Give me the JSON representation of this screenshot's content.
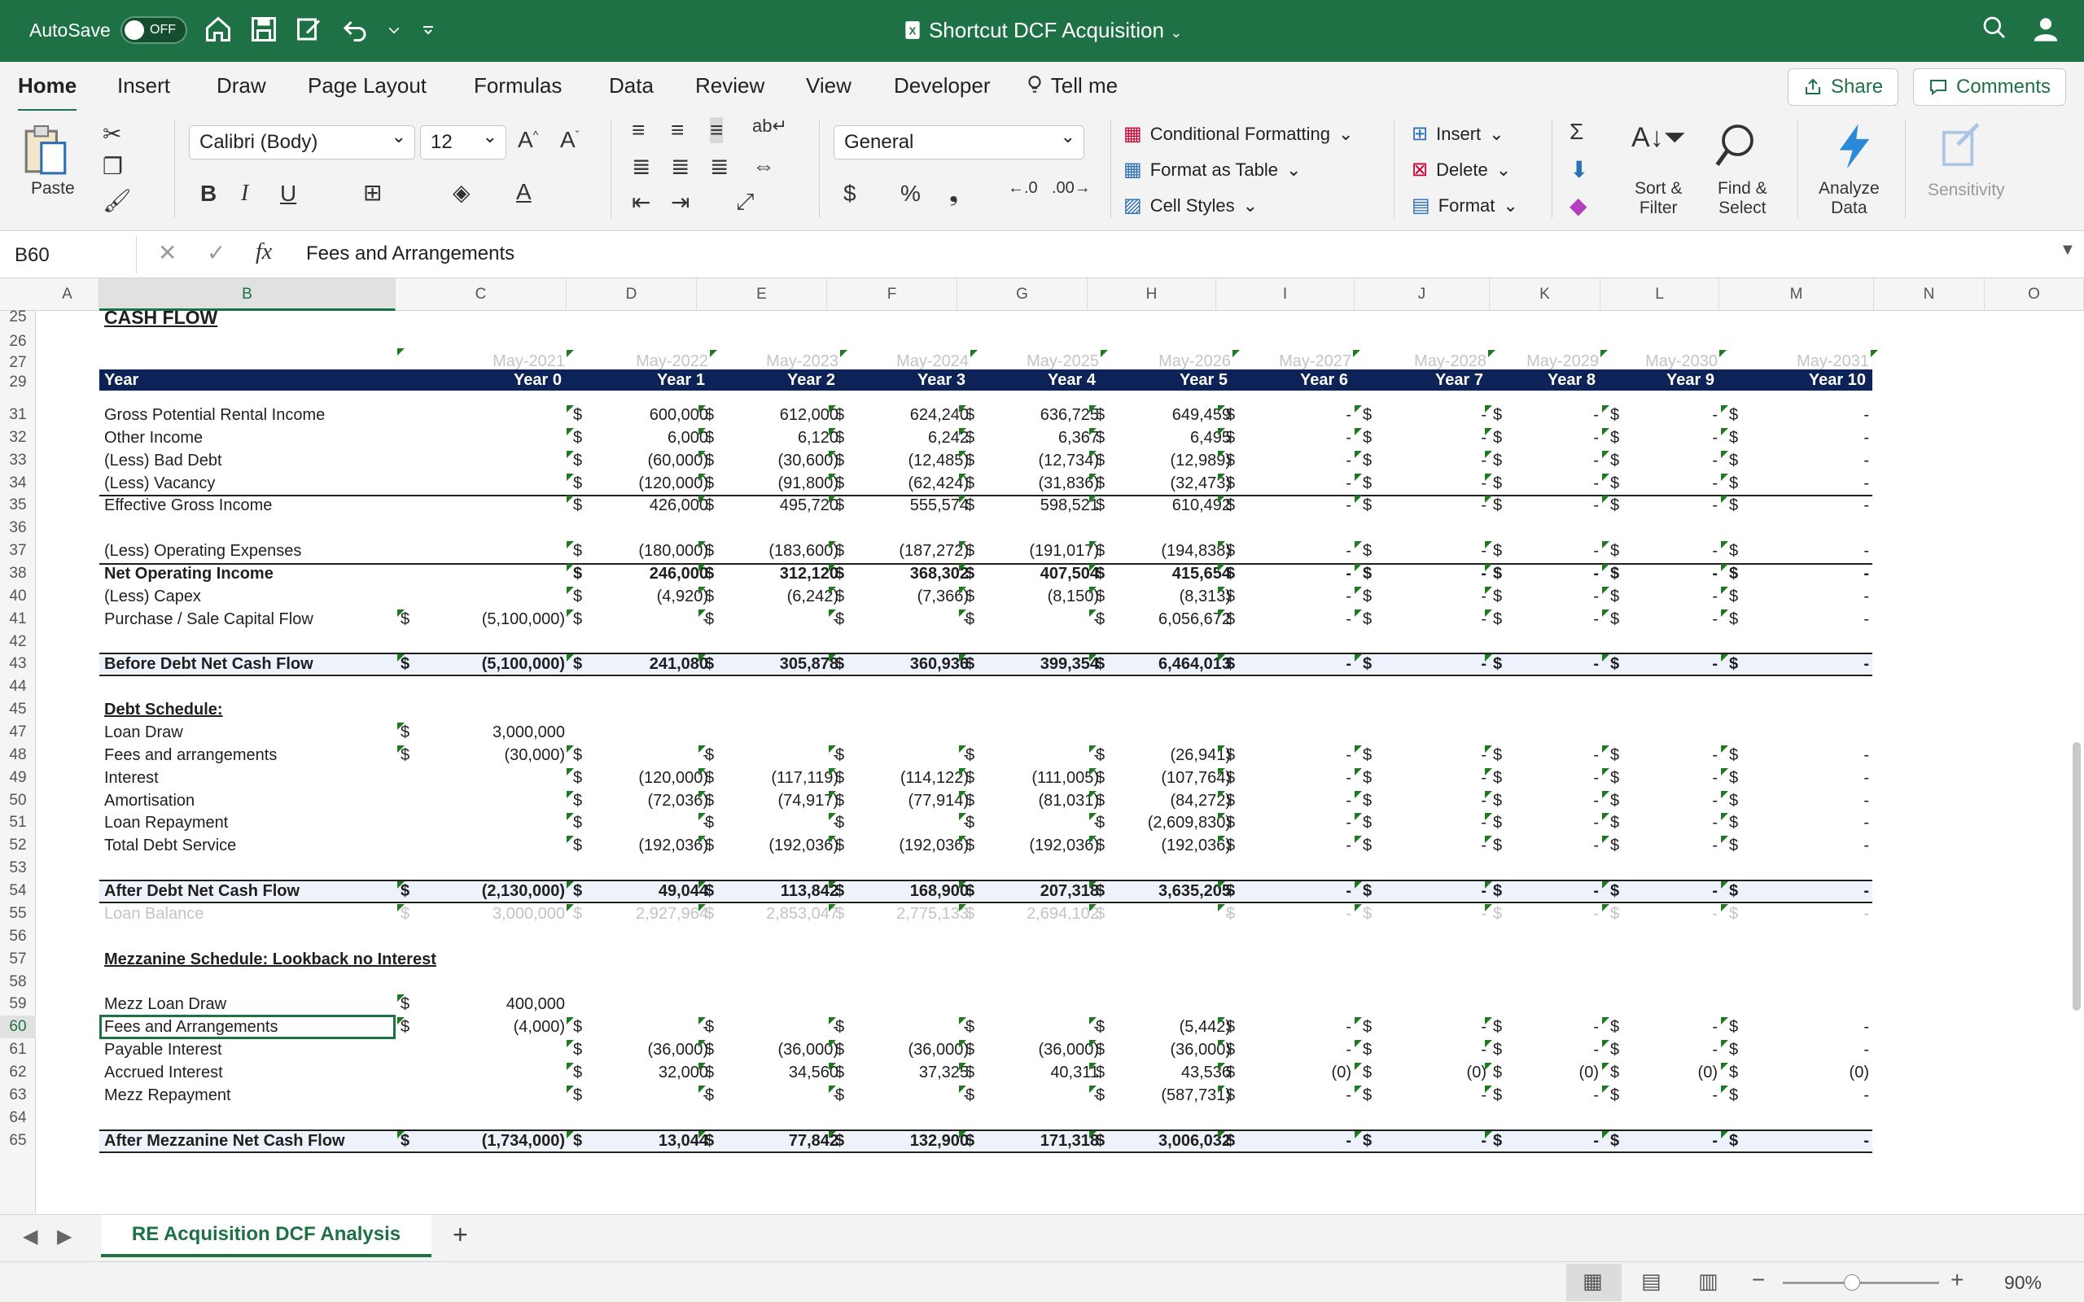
{
  "window": {
    "autosave_label": "AutoSave",
    "autosave_state": "OFF",
    "title": "Shortcut DCF Acquisition"
  },
  "ribbon_tabs": [
    "Home",
    "Insert",
    "Draw",
    "Page Layout",
    "Formulas",
    "Data",
    "Review",
    "View",
    "Developer"
  ],
  "tell_me": "Tell me",
  "share_label": "Share",
  "comments_label": "Comments",
  "ribbon": {
    "paste_label": "Paste",
    "font_name": "Calibri (Body)",
    "font_size": "12",
    "number_format": "General",
    "conditional_formatting": "Conditional Formatting",
    "format_as_table": "Format as Table",
    "cell_styles": "Cell Styles",
    "insert": "Insert",
    "delete": "Delete",
    "format": "Format",
    "sort_filter_1": "Sort &",
    "sort_filter_2": "Filter",
    "find_select_1": "Find &",
    "find_select_2": "Select",
    "analyze_1": "Analyze",
    "analyze_2": "Data",
    "sensitivity": "Sensitivity"
  },
  "formula_bar": {
    "name_box": "B60",
    "formula": "Fees and Arrangements"
  },
  "columns": [
    "A",
    "B",
    "C",
    "D",
    "E",
    "F",
    "G",
    "H",
    "I",
    "J",
    "K",
    "L",
    "M",
    "N",
    "O"
  ],
  "selected_column": "B",
  "selected_row": "60",
  "sheet": {
    "section_title": "CASH FLOW",
    "dates": [
      "May-2021",
      "May-2022",
      "May-2023",
      "May-2024",
      "May-2025",
      "May-2026",
      "May-2027",
      "May-2028",
      "May-2029",
      "May-2030",
      "May-2031"
    ],
    "header_label": "Year",
    "years": [
      "Year 0",
      "Year 1",
      "Year 2",
      "Year 3",
      "Year 4",
      "Year 5",
      "Year 6",
      "Year 7",
      "Year 8",
      "Year 9",
      "Year 10"
    ],
    "rows": [
      {
        "row": "31",
        "label": "Gross Potential Rental Income",
        "values": [
          "",
          "600,000",
          "612,000",
          "624,240",
          "636,725",
          "649,459",
          "-",
          "-",
          "-",
          "-",
          "-"
        ]
      },
      {
        "row": "32",
        "label": "Other Income",
        "values": [
          "",
          "6,000",
          "6,120",
          "6,242",
          "6,367",
          "6,495",
          "-",
          "-",
          "-",
          "-",
          "-"
        ]
      },
      {
        "row": "33",
        "label": "(Less) Bad Debt",
        "values": [
          "",
          "(60,000)",
          "(30,600)",
          "(12,485)",
          "(12,734)",
          "(12,989)",
          "-",
          "-",
          "-",
          "-",
          "-"
        ]
      },
      {
        "row": "34",
        "label": "(Less) Vacancy",
        "values": [
          "",
          "(120,000)",
          "(91,800)",
          "(62,424)",
          "(31,836)",
          "(32,473)",
          "-",
          "-",
          "-",
          "-",
          "-"
        ]
      },
      {
        "row": "35",
        "label": "Effective Gross Income",
        "values": [
          "",
          "426,000",
          "495,720",
          "555,574",
          "598,521",
          "610,492",
          "-",
          "-",
          "-",
          "-",
          "-"
        ]
      },
      {
        "row": "37",
        "label": "(Less) Operating Expenses",
        "values": [
          "",
          "(180,000)",
          "(183,600)",
          "(187,272)",
          "(191,017)",
          "(194,838)",
          "-",
          "-",
          "-",
          "-",
          "-"
        ]
      },
      {
        "row": "38",
        "label": "Net Operating Income",
        "values": [
          "",
          "246,000",
          "312,120",
          "368,302",
          "407,504",
          "415,654",
          "-",
          "-",
          "-",
          "-",
          "-"
        ]
      },
      {
        "row": "40",
        "label": "(Less) Capex",
        "values": [
          "",
          "(4,920)",
          "(6,242)",
          "(7,366)",
          "(8,150)",
          "(8,313)",
          "-",
          "-",
          "-",
          "-",
          "-"
        ]
      },
      {
        "row": "41",
        "label": "Purchase / Sale Capital Flow",
        "values": [
          "(5,100,000)",
          "-",
          "-",
          "-",
          "-",
          "6,056,672",
          "-",
          "-",
          "-",
          "-",
          "-"
        ]
      },
      {
        "row": "43",
        "label": "Before Debt Net Cash Flow",
        "values": [
          "(5,100,000)",
          "241,080",
          "305,878",
          "360,936",
          "399,354",
          "6,464,013",
          "-",
          "-",
          "-",
          "-",
          "-"
        ]
      },
      {
        "row": "45",
        "label": "Debt Schedule:",
        "values": []
      },
      {
        "row": "47",
        "label": "Loan Draw",
        "values": [
          "3,000,000",
          "",
          "",
          "",
          "",
          "",
          "",
          "",
          "",
          "",
          ""
        ]
      },
      {
        "row": "48",
        "label": "Fees and arrangements",
        "values": [
          "(30,000)",
          "-",
          "-",
          "-",
          "-",
          "(26,941)",
          "-",
          "-",
          "-",
          "-",
          "-"
        ]
      },
      {
        "row": "49",
        "label": "Interest",
        "values": [
          "",
          "(120,000)",
          "(117,119)",
          "(114,122)",
          "(111,005)",
          "(107,764)",
          "-",
          "-",
          "-",
          "-",
          "-"
        ]
      },
      {
        "row": "50",
        "label": "Amortisation",
        "values": [
          "",
          "(72,036)",
          "(74,917)",
          "(77,914)",
          "(81,031)",
          "(84,272)",
          "-",
          "-",
          "-",
          "-",
          "-"
        ]
      },
      {
        "row": "51",
        "label": "Loan Repayment",
        "values": [
          "",
          "-",
          "-",
          "-",
          "-",
          "(2,609,830)",
          "-",
          "-",
          "-",
          "-",
          "-"
        ]
      },
      {
        "row": "52",
        "label": "Total Debt Service",
        "values": [
          "",
          "(192,036)",
          "(192,036)",
          "(192,036)",
          "(192,036)",
          "(192,036)",
          "-",
          "-",
          "-",
          "-",
          "-"
        ]
      },
      {
        "row": "54",
        "label": "After Debt Net Cash Flow",
        "values": [
          "(2,130,000)",
          "49,044",
          "113,842",
          "168,900",
          "207,318",
          "3,635,205",
          "-",
          "-",
          "-",
          "-",
          "-"
        ]
      },
      {
        "row": "55",
        "label": "Loan Balance",
        "values": [
          "3,000,000",
          "2,927,964",
          "2,853,047",
          "2,775,133",
          "2,694,102",
          "-",
          "-",
          "-",
          "-",
          "-",
          "-"
        ]
      },
      {
        "row": "57",
        "label": "Mezzanine Schedule: Lookback no Interest",
        "values": []
      },
      {
        "row": "59",
        "label": "Mezz Loan Draw",
        "values": [
          "400,000",
          "",
          "",
          "",
          "",
          "",
          "",
          "",
          "",
          "",
          ""
        ]
      },
      {
        "row": "60",
        "label": "Fees and Arrangements",
        "values": [
          "(4,000)",
          "-",
          "-",
          "-",
          "-",
          "(5,442)",
          "-",
          "-",
          "-",
          "-",
          "-"
        ]
      },
      {
        "row": "61",
        "label": "Payable Interest",
        "values": [
          "",
          "(36,000)",
          "(36,000)",
          "(36,000)",
          "(36,000)",
          "(36,000)",
          "-",
          "-",
          "-",
          "-",
          "-"
        ]
      },
      {
        "row": "62",
        "label": "Accrued Interest",
        "values": [
          "",
          "32,000",
          "34,560",
          "37,325",
          "40,311",
          "43,536",
          "(0)",
          "(0)",
          "(0)",
          "(0)",
          "(0)"
        ]
      },
      {
        "row": "63",
        "label": "Mezz Repayment",
        "values": [
          "",
          "-",
          "-",
          "-",
          "-",
          "(587,731)",
          "-",
          "-",
          "-",
          "-",
          "-"
        ]
      },
      {
        "row": "65",
        "label": "After Mezzanine Net Cash Flow",
        "values": [
          "(1,734,000)",
          "13,044",
          "77,842",
          "132,900",
          "171,318",
          "3,006,032",
          "-",
          "-",
          "-",
          "-",
          "-"
        ]
      }
    ]
  },
  "sheet_tab": "RE Acquisition DCF Analysis",
  "currency_symbol": "$",
  "zoom": "90%"
}
